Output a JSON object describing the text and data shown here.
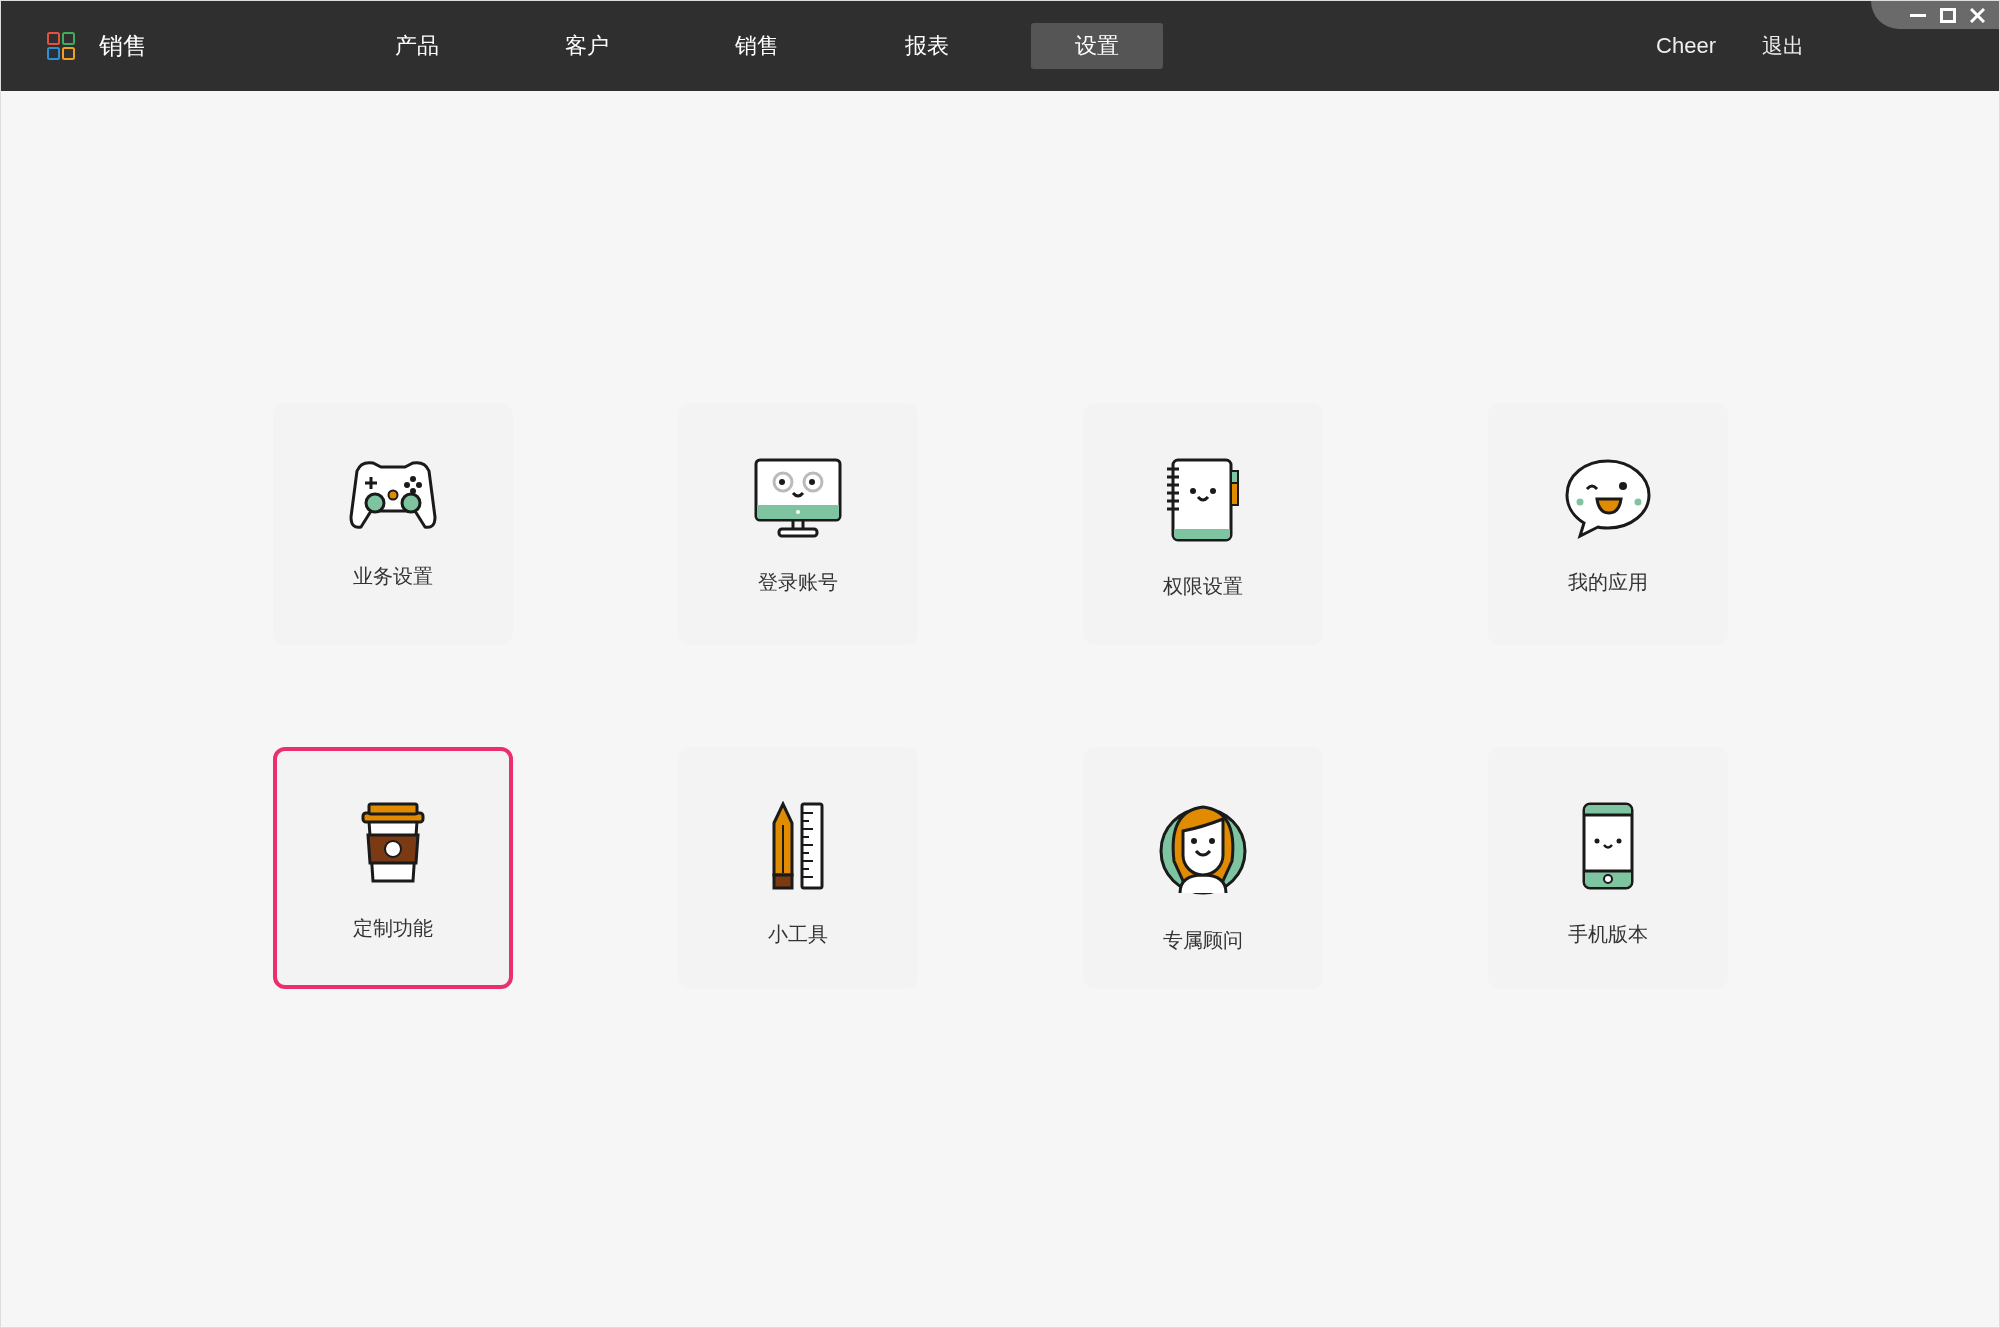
{
  "header": {
    "brand": "销售",
    "nav": [
      {
        "label": "产品",
        "selected": false
      },
      {
        "label": "客户",
        "selected": false
      },
      {
        "label": "销售",
        "selected": false
      },
      {
        "label": "报表",
        "selected": false
      },
      {
        "label": "设置",
        "selected": true
      }
    ],
    "user": "Cheer",
    "logout": "退出"
  },
  "tiles": [
    {
      "label": "业务设置",
      "selected": false
    },
    {
      "label": "登录账号",
      "selected": false
    },
    {
      "label": "权限设置",
      "selected": false
    },
    {
      "label": "我的应用",
      "selected": false
    },
    {
      "label": "定制功能",
      "selected": true
    },
    {
      "label": "小工具",
      "selected": false
    },
    {
      "label": "专属顾问",
      "selected": false
    },
    {
      "label": "手机版本",
      "selected": false
    }
  ]
}
